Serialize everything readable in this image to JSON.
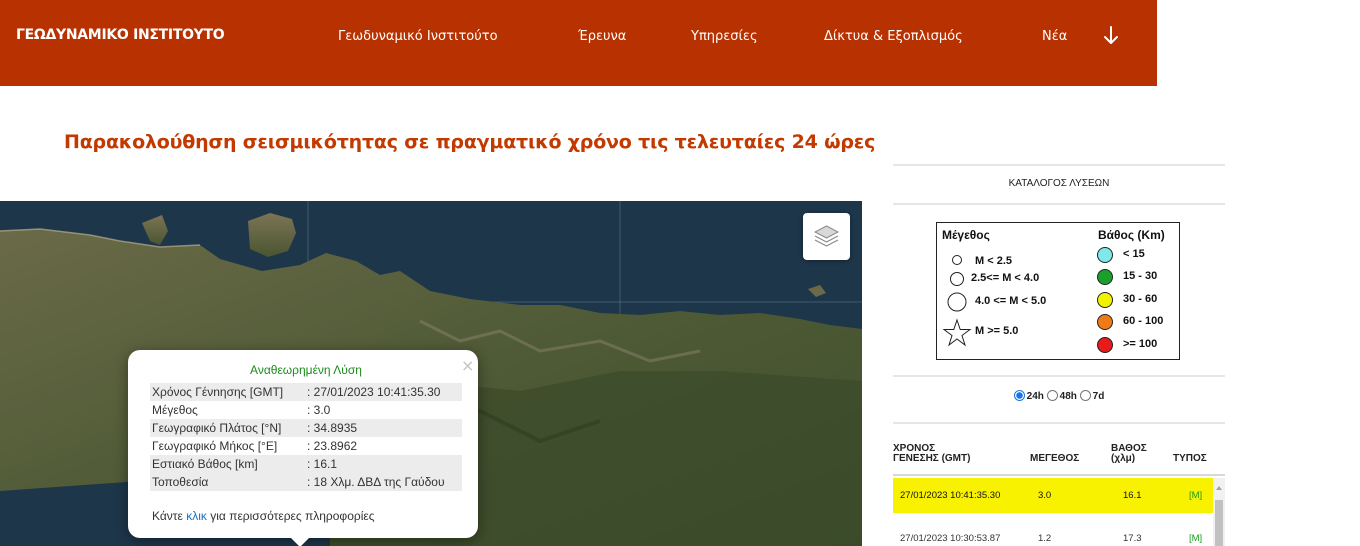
{
  "header": {
    "brand": "ΓΕΩΔΥΝΑΜΙΚΟ ΙΝΣΤΙΤΟΥΤΟ",
    "nav": [
      {
        "label": "Γεωδυναμικό Ινστιτούτο"
      },
      {
        "label": "Έρευνα"
      },
      {
        "label": "Υπηρεσίες"
      },
      {
        "label": "Δίκτυα & Εξοπλισμός"
      },
      {
        "label": "Νέα"
      }
    ],
    "bg_color": "#b83100"
  },
  "page_title": "Παρακολούθηση σεισμικότητας σε πραγματικό χρόνο τις τελευταίες 24 ώρες",
  "popup": {
    "title": "Αναθεωρημένη Λύση",
    "rows": [
      {
        "key": "Χρόνος Γένnησης [GMT]",
        "value": ": 27/01/2023 10:41:35.30"
      },
      {
        "key": "Μέγεθος",
        "value": ": 3.0"
      },
      {
        "key": "Γεωγραφικό Πλάτος [°N]",
        "value": ": 34.8935"
      },
      {
        "key": "Γεωγραφικό Μήκος [°E]",
        "value": ": 23.8962"
      },
      {
        "key": "Εστιακό Βάθος [km]",
        "value": ": 16.1"
      },
      {
        "key": "Τοποθεσία",
        "value": ": 18 Χλμ. ΔΒΔ της Γαύδου"
      }
    ],
    "footer_pre": "Κάντε ",
    "footer_link": "κλικ",
    "footer_post": " για περισσότερες πληροφορίες",
    "close": "×"
  },
  "catalog": {
    "title": "ΚΑΤΑΛΟΓΟΣ ΛΥΣΕΩΝ",
    "legend": {
      "magnitude_header": "Μέγεθος",
      "depth_header": "Βάθος (Km)",
      "magnitudes": [
        "M < 2.5",
        "2.5<= M < 4.0",
        "4.0 <= M < 5.0",
        "M >= 5.0"
      ],
      "depths": [
        {
          "label": "< 15",
          "color": "#7fe8e8"
        },
        {
          "label": "15 - 30",
          "color": "#1aa02a"
        },
        {
          "label": "30 - 60",
          "color": "#f2f200"
        },
        {
          "label": "60 - 100",
          "color": "#f07a1a"
        },
        {
          "label": ">= 100",
          "color": "#e81a1a"
        }
      ]
    },
    "periods": [
      {
        "label": "24h",
        "selected": true
      },
      {
        "label": "48h",
        "selected": false
      },
      {
        "label": "7d",
        "selected": false
      }
    ],
    "columns": {
      "time_line1": "ΧΡΟΝΟΣ",
      "time_line2": "ΓΕΝΕΣΗΣ (GMT)",
      "magnitude": "ΜΕΓΕΘΟΣ",
      "depth_line1": "ΒΑΘΟΣ",
      "depth_line2": "(χλμ)",
      "type": "ΤΥΠΟΣ"
    },
    "rows": [
      {
        "time": "27/01/2023 10:41:35.30",
        "mag": "3.0",
        "depth": "16.1",
        "type": "[M]",
        "highlight": true
      },
      {
        "time": "27/01/2023 10:30:53.87",
        "mag": "1.2",
        "depth": "17.3",
        "type": "[M]",
        "highlight": false
      }
    ],
    "type_color": "#1a9a1a",
    "highlight_color": "#f8f200"
  }
}
